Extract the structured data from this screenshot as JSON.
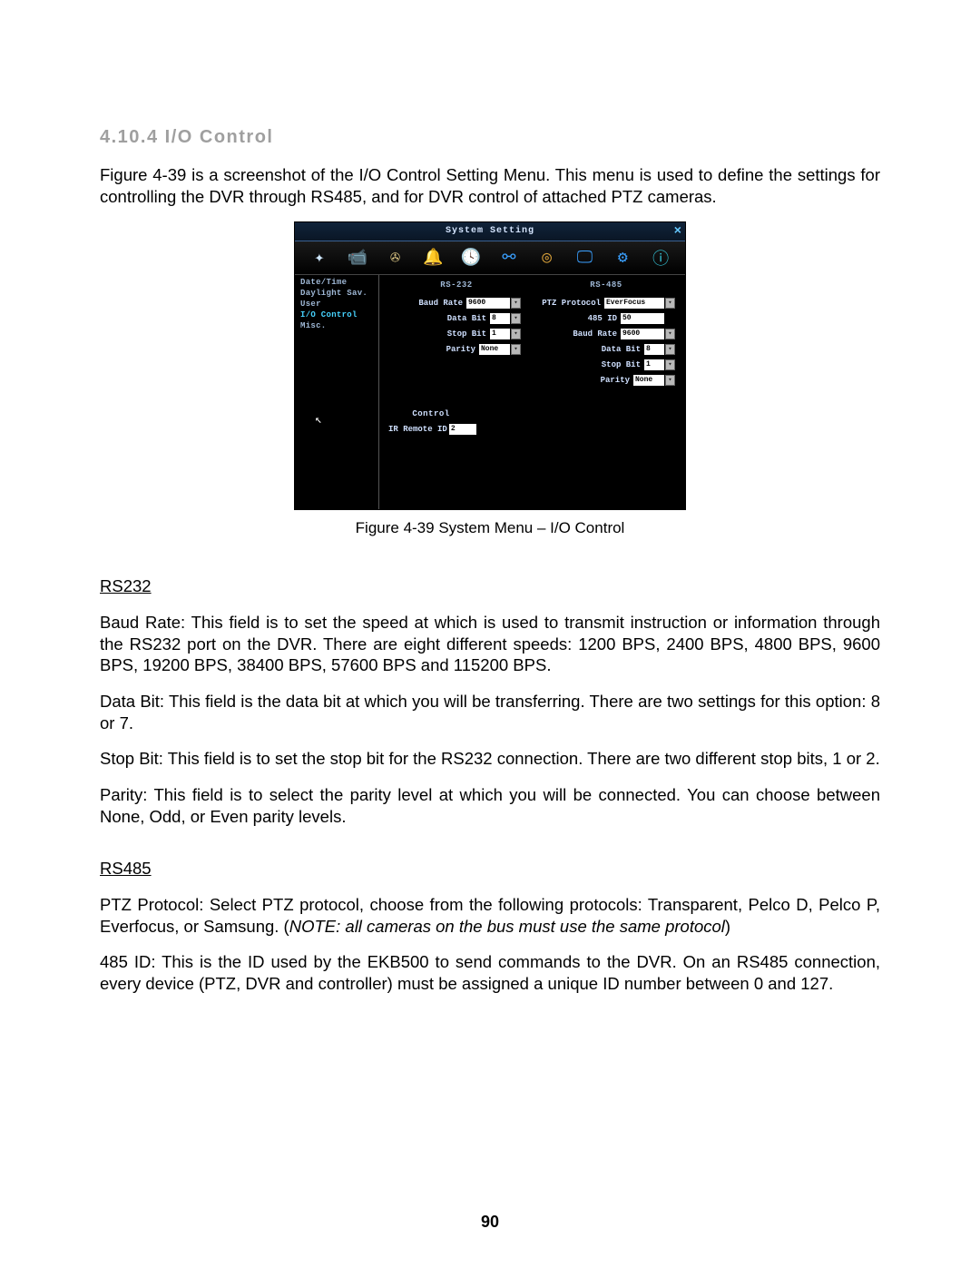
{
  "heading": "4.10.4 I/O Control",
  "intro": "Figure 4-39 is a screenshot of the I/O Control Setting Menu. This menu is used to define the settings for controlling the DVR through RS485, and for DVR control of attached PTZ cameras.",
  "figure_caption": "Figure 4-39 System Menu – I/O Control",
  "rs232_heading": "RS232",
  "rs232_baud_label": "Baud Rate:",
  "rs232_baud_text": " This field is to set the speed at which is used to transmit instruction or information through the RS232 port on the DVR. There are eight different speeds: 1200 BPS, 2400 BPS, 4800 BPS, 9600 BPS, 19200 BPS, 38400 BPS, 57600 BPS and 115200 BPS.",
  "rs232_databit_label": "Data Bit:",
  "rs232_databit_text": " This field is the data bit at which you will be transferring. There are two settings for this option: 8 or 7.",
  "rs232_stopbit_label": "Stop Bit:",
  "rs232_stopbit_text": " This field is to set the stop bit for the RS232 connection. There are two different stop bits, 1 or 2.",
  "rs232_parity_label": "Parity:",
  "rs232_parity_text": " This field is to select the parity level at which you will be connected. You can choose between None, Odd, or Even parity levels.",
  "rs485_heading": "RS485",
  "rs485_ptz_label": "PTZ Protocol:",
  "rs485_ptz_text": " Select PTZ protocol, choose from the following protocols: Transparent, Pelco D, Pelco P, Everfocus, or Samsung. (",
  "rs485_ptz_note": "NOTE: all cameras on the bus must use the same protocol",
  "rs485_ptz_tail": ")",
  "rs485_id_label": "485 ID:",
  "rs485_id_text": " This is the ID used by the EKB500 to send commands to the DVR. On an RS485 connection, every device (PTZ, DVR and controller) must be assigned a unique ID number between 0 and 127.",
  "page_number": "90",
  "screenshot": {
    "title": "System Setting",
    "sidebar": [
      {
        "label": "Date/Time"
      },
      {
        "label": "Daylight Sav."
      },
      {
        "label": "User"
      },
      {
        "label": "I/O Control",
        "active": true
      },
      {
        "label": "Misc."
      }
    ],
    "rs232": {
      "heading": "RS-232",
      "baud_label": "Baud Rate",
      "baud_value": "9600",
      "databit_label": "Data Bit",
      "databit_value": "8",
      "stopbit_label": "Stop Bit",
      "stopbit_value": "1",
      "parity_label": "Parity",
      "parity_value": "None"
    },
    "rs485": {
      "heading": "RS-485",
      "ptz_label": "PTZ Protocol",
      "ptz_value": "EverFocus",
      "id_label": "485 ID",
      "id_value": "50",
      "baud_label": "Baud Rate",
      "baud_value": "9600",
      "databit_label": "Data Bit",
      "databit_value": "8",
      "stopbit_label": "Stop Bit",
      "stopbit_value": "1",
      "parity_label": "Parity",
      "parity_value": "None"
    },
    "control": {
      "heading": "Control",
      "ir_label": "IR Remote ID",
      "ir_value": "2"
    },
    "toolbar_icons": [
      "sparkle",
      "camera",
      "reel",
      "bell",
      "clock",
      "network",
      "coins",
      "monitor",
      "gears",
      "info"
    ]
  }
}
